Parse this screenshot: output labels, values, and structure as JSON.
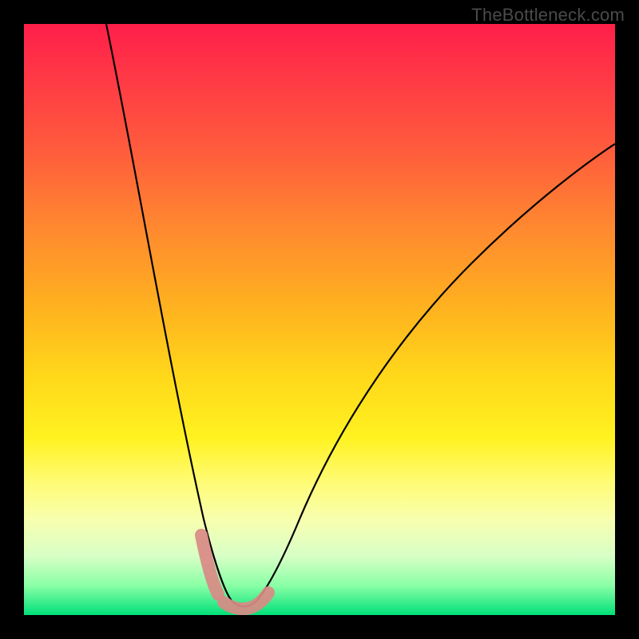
{
  "watermark": "TheBottleneck.com",
  "chart_data": {
    "type": "line",
    "title": "",
    "xlabel": "",
    "ylabel": "",
    "xlim": [
      0,
      100
    ],
    "ylim": [
      0,
      100
    ],
    "grid": false,
    "series": [
      {
        "name": "curve",
        "x": [
          14,
          16,
          18,
          20,
          22,
          24,
          26,
          28,
          30,
          30.5,
          31,
          32,
          33,
          34,
          35,
          36,
          37,
          38,
          39,
          40,
          42,
          45,
          50,
          55,
          60,
          65,
          70,
          75,
          80,
          85,
          90,
          95,
          100
        ],
        "y": [
          100,
          88,
          76,
          64,
          52,
          41,
          31,
          21,
          12,
          10,
          8,
          5,
          3,
          1.5,
          0.8,
          0.5,
          0.5,
          0.8,
          1.5,
          3,
          7,
          13,
          23,
          32,
          40,
          47,
          53,
          58,
          62,
          66,
          69,
          72,
          75
        ]
      },
      {
        "name": "highlight-left",
        "x": [
          30,
          30.5,
          31,
          31.5,
          32
        ],
        "y": [
          12,
          10,
          8,
          6.5,
          5
        ]
      },
      {
        "name": "highlight-bottom",
        "x": [
          33,
          34,
          35,
          36,
          37,
          38,
          39,
          40,
          41
        ],
        "y": [
          3,
          1.5,
          0.8,
          0.5,
          0.5,
          0.8,
          1.5,
          3,
          5
        ]
      }
    ],
    "annotations": []
  },
  "colors": {
    "curve": "#000000",
    "highlight": "#d98a86",
    "gradient_top": "#ff1f4a",
    "gradient_bottom": "#00e07a",
    "frame": "#000000"
  }
}
